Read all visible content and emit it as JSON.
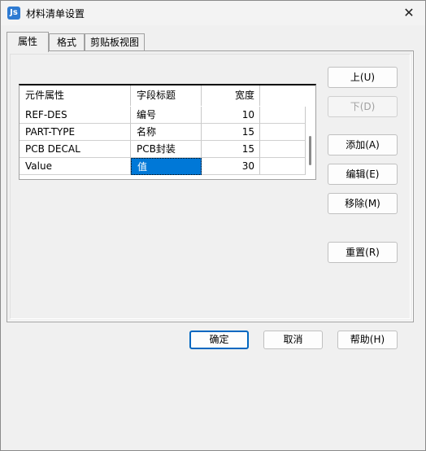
{
  "window": {
    "title": "材料清单设置",
    "close_glyph": "✕",
    "app_icon": "Js"
  },
  "tabs": [
    {
      "label": "属性",
      "active": true
    },
    {
      "label": "格式",
      "active": false
    },
    {
      "label": "剪贴板视图",
      "active": false
    }
  ],
  "grid": {
    "headers": [
      "元件属性",
      "字段标题",
      "宽度"
    ],
    "rows": [
      {
        "attr": "REF-DES",
        "title": "编号",
        "width": "10"
      },
      {
        "attr": "PART-TYPE",
        "title": "名称",
        "width": "15"
      },
      {
        "attr": "PCB DECAL",
        "title": "PCB封装",
        "width": "15"
      },
      {
        "attr": "Value",
        "title": "值",
        "width": "30"
      }
    ]
  },
  "side_buttons": {
    "up": "上(U)",
    "down": "下(D)",
    "add": "添加(A)",
    "edit": "编辑(E)",
    "remove": "移除(M)",
    "reset": "重置(R)"
  },
  "footer_buttons": {
    "ok": "确定",
    "cancel": "取消",
    "help": "帮助(H)"
  },
  "colors": {
    "selection": "#0078d7",
    "default_button_border": "#0067c0"
  }
}
